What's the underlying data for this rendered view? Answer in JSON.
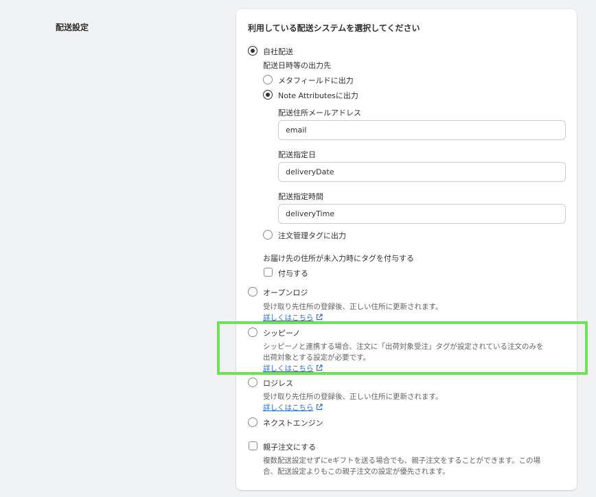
{
  "section_title": "配送設定",
  "card_title": "利用している配送システムを選択してください",
  "own_delivery": {
    "label": "自社配送",
    "output_heading": "配送日時等の出力先",
    "metafield_label": "メタフィールドに出力",
    "note_attr_label": "Note Attributesに出力",
    "email_label": "配送住所メールアドレス",
    "email_value": "email",
    "date_label": "配送指定日",
    "date_value": "deliveryDate",
    "time_label": "配送指定時間",
    "time_value": "deliveryTime",
    "order_tag_label": "注文管理タグに出力",
    "missing_address_heading": "お届け先の住所が未入力時にタグを付与する",
    "add_tag_label": "付与する"
  },
  "openlogi": {
    "label": "オープンロジ",
    "description": "受け取り先住所の登録後、正しい住所に更新されます。",
    "link": "詳しくはこちら"
  },
  "shippino": {
    "label": "シッピーノ",
    "description_line1": "シッピーノと連携する場合、注文に「出荷対象受注」タグが設定されている注文のみを",
    "description_line2": "出荷対象とする設定が必要です。",
    "link": "詳しくはこちら"
  },
  "logiless": {
    "label": "ロジレス",
    "description": "受け取り先住所の登録後、正しい住所に更新されます。",
    "link": "詳しくはこちら"
  },
  "next_engine": {
    "label": "ネクストエンジン"
  },
  "parent_order": {
    "label": "親子注文にする",
    "description_line1": "複数配送設定せずにeギフトを送る場合でも、親子注文をすることができます。この場",
    "description_line2": "合、配送設定よりもこの親子注文の設定が優先されます。"
  },
  "colors": {
    "link": "#2c6ecb",
    "highlight": "#6ee05a",
    "background": "#f1f2f4"
  }
}
